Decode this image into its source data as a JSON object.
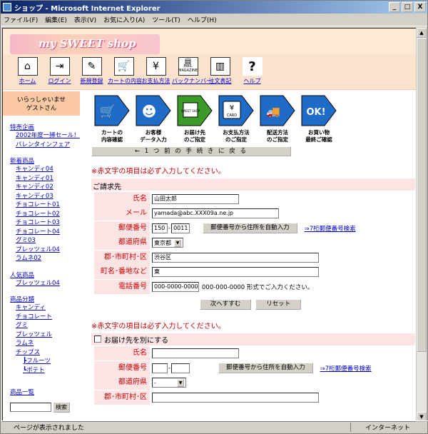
{
  "window": {
    "title": "ショップ - Microsoft Internet Explorer",
    "btn_min": "_",
    "btn_max": "□",
    "btn_close": "X"
  },
  "menu": [
    "ファイル(F)",
    "編集(E)",
    "表示(V)",
    "お気に入り(A)",
    "ツール(T)",
    "ヘルプ(H)"
  ],
  "logo": "my SWEET shop",
  "nav": [
    {
      "label": "ホーム",
      "glyph": "⌂"
    },
    {
      "label": "ログイン",
      "glyph": "⇥"
    },
    {
      "label": "新規登録",
      "glyph": "✎"
    },
    {
      "label": "カートの内容",
      "glyph": "🛒"
    },
    {
      "label": "お支払方法",
      "glyph": "¥"
    },
    {
      "label": "バックナンバー",
      "glyph": "▤",
      "subtext": "MAIL MAGAZINE"
    },
    {
      "label": "注文表記",
      "glyph": "▥"
    },
    {
      "label": "ヘルプ",
      "glyph": "?"
    }
  ],
  "sidebar": {
    "welcome_1": "いらっしゃいませ",
    "welcome_2": "ゲストさん",
    "special_head": "特売企画",
    "special": [
      "2002年度一掃セール！",
      "バレンタインフェア"
    ],
    "new_head": "新着商品",
    "new_items": [
      "キャンディ04",
      "キャンディ01",
      "キャンディ02",
      "キャンディ03",
      "チョコレート01",
      "チョコレート02",
      "チョコレート03",
      "チョコレート04",
      "グミ03",
      "プレッツェル04",
      "ラムネ02"
    ],
    "popular_head": "人気商品",
    "popular": [
      "プレッツェル04"
    ],
    "category_head": "商品分類",
    "categories": [
      "キャンディ",
      "チョコレート",
      "グミ",
      "プレッツェル",
      "ラムネ",
      "チップス"
    ],
    "chip_subs": [
      "フルーツ",
      "ポテト"
    ],
    "list_head": "商品一覧",
    "search_button": "検索"
  },
  "steps": [
    {
      "line1": "カートの",
      "line2": "内容確認",
      "color": "#1e6bc8",
      "glyph": "🛒"
    },
    {
      "line1": "お客様",
      "line2": "データ入力",
      "color": "#1e6bc8",
      "glyph": "☻"
    },
    {
      "line1": "お届け先",
      "line2": "のご指定",
      "color": "#3c9a28",
      "glyph": "▣",
      "caption": "SWEET SHOP"
    },
    {
      "line1": "お支払方法",
      "line2": "のご指定",
      "color": "#1e6bc8",
      "glyph": "¥",
      "caption": "CARD"
    },
    {
      "line1": "配送方法",
      "line2": "のご指定",
      "color": "#1e6bc8",
      "glyph": "🚚"
    },
    {
      "line1": "お買い物",
      "line2": "最終ご確認",
      "color": "#1e6bc8",
      "glyph": "OK!"
    }
  ],
  "back_button": "← 1 つ 前 の 手 続 き に 戻 る",
  "required_note": "※赤文字の項目は必ず入力してください。",
  "billing": {
    "title": "ご請求先",
    "name_label": "氏名",
    "name_value": "山田太郎",
    "email_label": "メール",
    "email_value": "yamada@abc.XXX09a.ne.jp",
    "zip_label": "郵便番号",
    "zip1": "150",
    "zip2": "0011",
    "zip_button": "郵便番号から住所を自動入力",
    "zip_link": "⇒7桁郵便番号検索",
    "pref_label": "都道府県",
    "pref_value": "東京都",
    "city_label": "郡･市町村･区",
    "city_value": "渋谷区",
    "addr_label": "町名･番地など",
    "addr_value": "東",
    "tel_label": "電話番号",
    "tel_placeholder": "000-0000-0000",
    "tel_hint": "000-000-0000 形式でご入力ください。"
  },
  "buttons": {
    "next": "次へすすむ",
    "reset": "リセット"
  },
  "delivery": {
    "required_note": "※赤文字の項目は必ず入力してください。",
    "checkbox_label": "お届け先を別にする",
    "name_label": "氏名",
    "zip_label": "郵便番号",
    "zip_button": "郵便番号から住所を自動入力",
    "zip_link": "⇒7桁郵便番号検索",
    "pref_label": "都道府県",
    "pref_value": "-",
    "city_label": "郡･市町村･区"
  },
  "status": {
    "text": "ページが表示されました",
    "zone": "インターネット"
  },
  "colors": {
    "accent_pink": "#fde4e4",
    "header_peach": "#fbe2cc",
    "required_red": "#cc0000",
    "link_blue": "#0000cc"
  }
}
